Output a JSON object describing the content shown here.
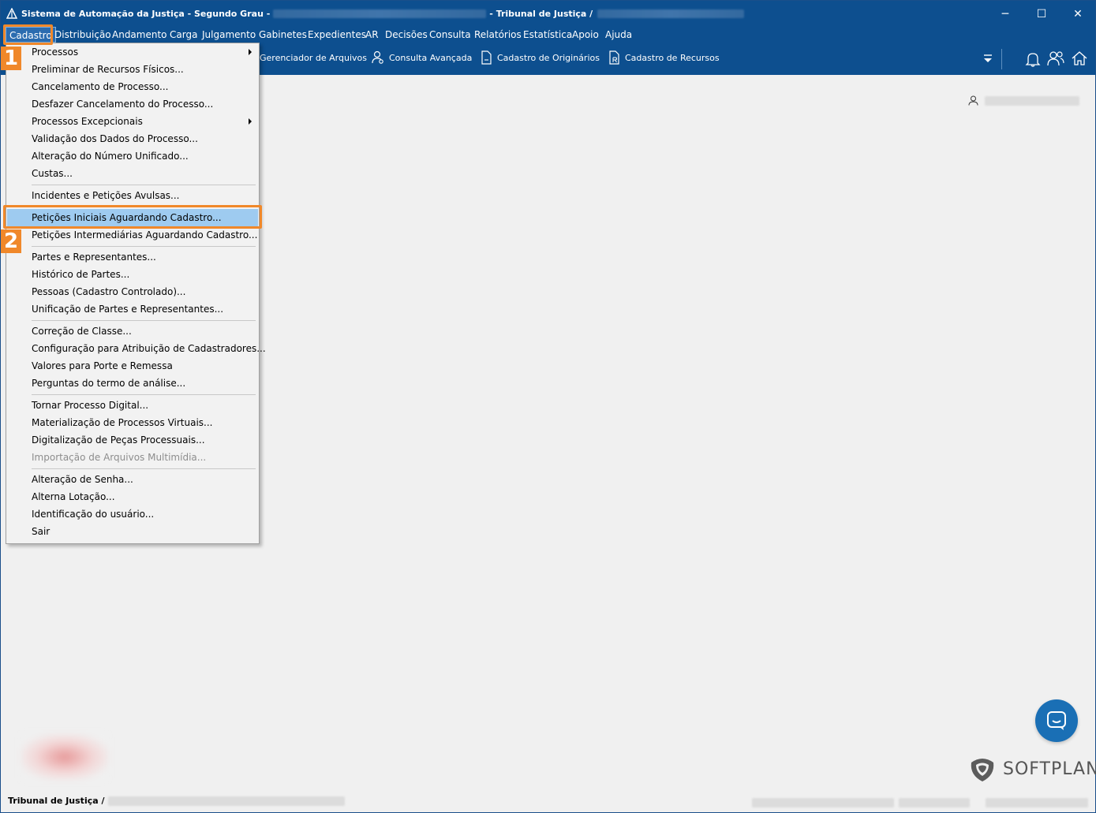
{
  "window": {
    "title": "Sistema de Automação da Justiça - Segundo Grau -",
    "title_mid": "- Tribunal de Justiça /",
    "controls": {
      "minimize": "─",
      "maximize": "☐",
      "close": "✕"
    }
  },
  "menubar": {
    "items": [
      "Cadastro",
      "Distribuição",
      "Andamento",
      "Carga",
      "Julgamento",
      "Gabinetes",
      "Expedientes",
      "AR",
      "Decisões",
      "Consulta",
      "Relatórios",
      "Estatística",
      "Apoio",
      "Ajuda"
    ],
    "active": "Cadastro"
  },
  "toolbar": {
    "items": [
      "Gerenciador de Arquivos",
      "Consulta Avançada",
      "Cadastro de Originários",
      "Cadastro de Recursos"
    ]
  },
  "dropdown": {
    "items": [
      {
        "label": "Processos",
        "submenu": true
      },
      {
        "label": "Preliminar de Recursos Físicos..."
      },
      {
        "label": "Cancelamento de Processo..."
      },
      {
        "label": "Desfazer Cancelamento do Processo..."
      },
      {
        "label": "Processos Excepcionais",
        "submenu": true
      },
      {
        "label": "Validação dos Dados do Processo..."
      },
      {
        "label": "Alteração do Número Unificado..."
      },
      {
        "label": "Custas..."
      },
      {
        "label": "Incidentes e Petições Avulsas..."
      },
      {
        "label": "Petições Iniciais Aguardando Cadastro...",
        "highlighted": true
      },
      {
        "label": "Petições Intermediárias Aguardando Cadastro..."
      },
      {
        "label": "Partes e Representantes..."
      },
      {
        "label": "Histórico de Partes..."
      },
      {
        "label": "Pessoas (Cadastro Controlado)..."
      },
      {
        "label": "Unificação de Partes e Representantes..."
      },
      {
        "label": "Correção de Classe..."
      },
      {
        "label": "Configuração para Atribuição de Cadastradores..."
      },
      {
        "label": "Valores para Porte e Remessa"
      },
      {
        "label": "Perguntas do termo de análise..."
      },
      {
        "label": "Tornar Processo Digital..."
      },
      {
        "label": "Materialização de Processos Virtuais..."
      },
      {
        "label": "Digitalização de Peças Processuais..."
      },
      {
        "label": "Importação de Arquivos Multimídia...",
        "disabled": true
      },
      {
        "label": "Alteração de Senha..."
      },
      {
        "label": "Alterna Lotação..."
      },
      {
        "label": "Identificação do usuário..."
      },
      {
        "label": "Sair"
      }
    ]
  },
  "callouts": {
    "first": "1",
    "second": "2"
  },
  "brand": {
    "name": "SOFTPLAN"
  },
  "status": {
    "text": "Tribunal de Justiça /"
  },
  "colors": {
    "titlebar": "#0d4f8f",
    "highlight": "#9ecbf0",
    "callout": "#f0882a",
    "chat": "#1a6fb5"
  }
}
